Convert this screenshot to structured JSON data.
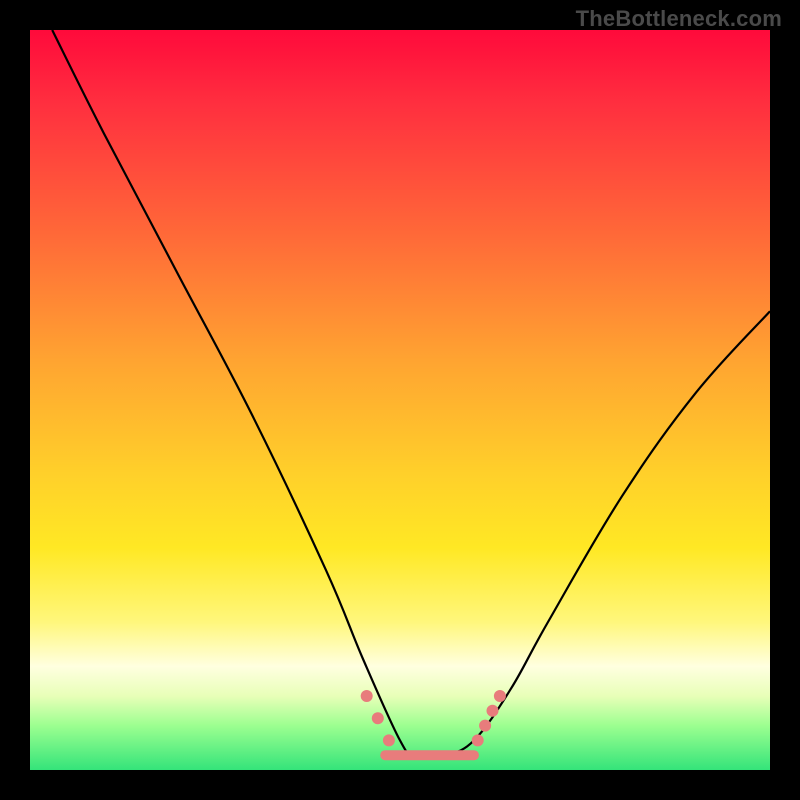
{
  "attribution": "TheBottleneck.com",
  "chart_data": {
    "type": "line",
    "title": "",
    "xlabel": "",
    "ylabel": "",
    "xlim": [
      0,
      100
    ],
    "ylim": [
      0,
      100
    ],
    "series": [
      {
        "name": "curve",
        "x": [
          3,
          10,
          20,
          30,
          40,
          45,
          50,
          52,
          56,
          60,
          65,
          70,
          80,
          90,
          100
        ],
        "y": [
          100,
          86,
          67,
          48,
          27,
          15,
          4,
          2,
          2,
          4,
          11,
          20,
          37,
          51,
          62
        ]
      }
    ],
    "accent_segment": {
      "x_start": 48,
      "x_end": 60,
      "y": 2
    },
    "accent_points": [
      {
        "x": 45.5,
        "y": 10
      },
      {
        "x": 47.0,
        "y": 7
      },
      {
        "x": 48.5,
        "y": 4
      },
      {
        "x": 60.5,
        "y": 4
      },
      {
        "x": 61.5,
        "y": 6
      },
      {
        "x": 62.5,
        "y": 8
      },
      {
        "x": 63.5,
        "y": 10
      }
    ]
  }
}
